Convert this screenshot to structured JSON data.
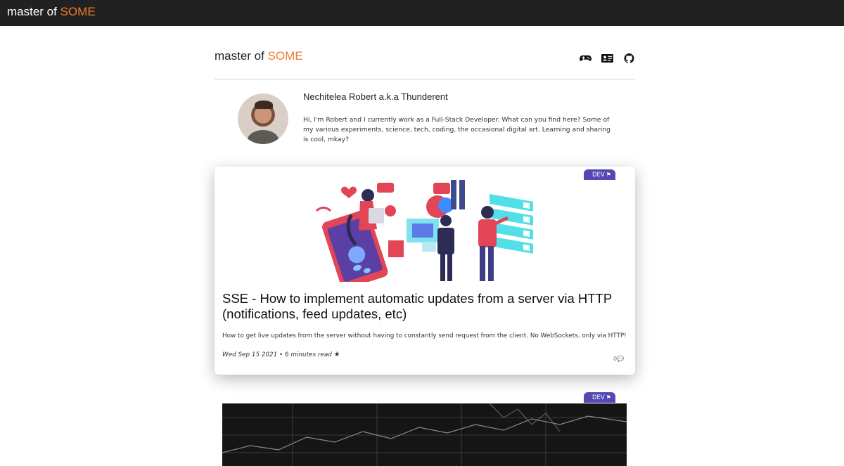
{
  "navbar": {
    "brand_prefix": "master of ",
    "brand_accent": "SOME"
  },
  "header": {
    "title_prefix": "master of ",
    "title_accent": "SOME",
    "icons": [
      "gamepad-icon",
      "id-card-icon",
      "github-icon"
    ]
  },
  "profile": {
    "name": "Nechitelea Robert a.k.a Thunderent",
    "bio": "Hi, I'm Robert and I currently work as a Full-Stack Developer. What can you find here? Some of my various experiments, science, tech, coding, the occasional digital art. Learning and sharing is cool, mkay?"
  },
  "posts": [
    {
      "tag": "DEV",
      "title": "SSE - How to implement automatic updates from a server via HTTP (notifications, feed updates, etc)",
      "excerpt": "How to get live updates from the server without having to constantly send request from the client. No WebSockets, only via HTTP!",
      "meta": "Wed Sep 15 2021 • 6 minutes read",
      "comments": "0"
    },
    {
      "tag": "DEV"
    }
  ],
  "colors": {
    "accent": "#ee7b2c",
    "tag": "#5448b5",
    "navbar": "#212121"
  }
}
